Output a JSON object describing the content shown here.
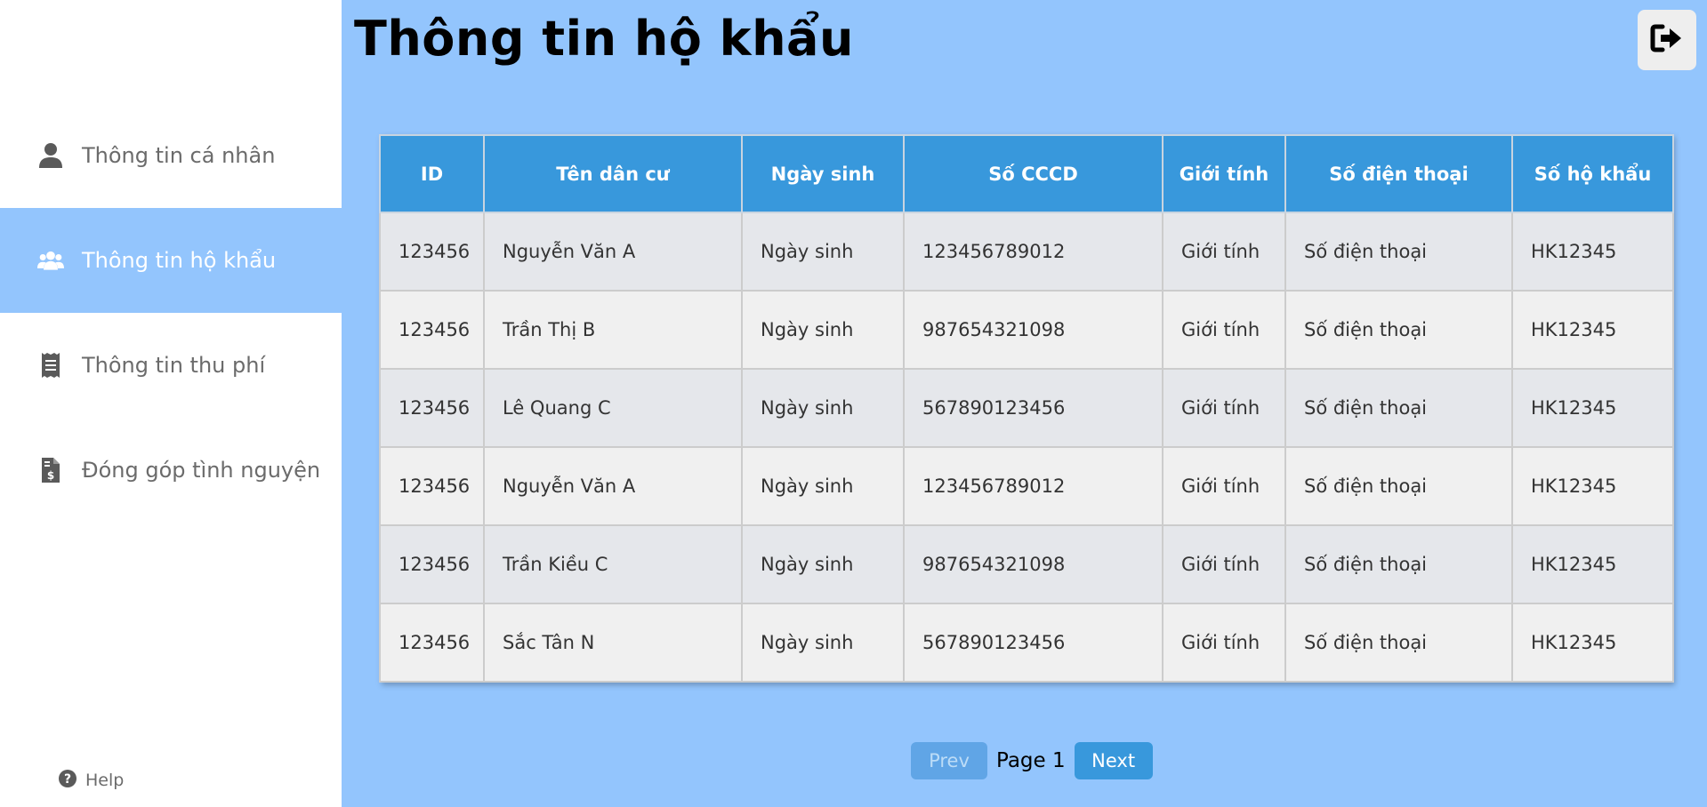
{
  "sidebar": {
    "items": [
      {
        "label": "Thông tin cá nhân",
        "icon": "user-icon"
      },
      {
        "label": "Thông tin hộ khẩu",
        "icon": "users-icon",
        "active": true
      },
      {
        "label": "Thông tin thu phí",
        "icon": "receipt-icon"
      },
      {
        "label": "Đóng góp tình nguyện",
        "icon": "file-invoice-dollar-icon"
      }
    ],
    "help_label": "Help"
  },
  "header": {
    "title": "Thông tin hộ khẩu",
    "logout_icon": "sign-out-icon"
  },
  "table": {
    "columns": [
      "ID",
      "Tên dân cư",
      "Ngày sinh",
      "Số CCCD",
      "Giới tính",
      "Số điện thoại",
      "Số hộ khẩu"
    ],
    "rows": [
      [
        "123456",
        "Nguyễn Văn A",
        "Ngày sinh",
        "123456789012",
        "Giới tính",
        "Số điện thoại",
        "HK12345"
      ],
      [
        "123456",
        "Trần Thị B",
        "Ngày sinh",
        "987654321098",
        "Giới tính",
        "Số điện thoại",
        "HK12345"
      ],
      [
        "123456",
        "Lê Quang C",
        "Ngày sinh",
        "567890123456",
        "Giới tính",
        "Số điện thoại",
        "HK12345"
      ],
      [
        "123456",
        "Nguyễn Văn A",
        "Ngày sinh",
        "123456789012",
        "Giới tính",
        "Số điện thoại",
        "HK12345"
      ],
      [
        "123456",
        "Trần Kiều C",
        "Ngày sinh",
        "987654321098",
        "Giới tính",
        "Số điện thoại",
        "HK12345"
      ],
      [
        "123456",
        "Sắc Tân N",
        "Ngày sinh",
        "567890123456",
        "Giới tính",
        "Số điện thoại",
        "HK12345"
      ]
    ]
  },
  "pagination": {
    "prev_label": "Prev",
    "page_label": "Page 1",
    "next_label": "Next"
  },
  "colors": {
    "background": "#93c5fd",
    "header": "#3898dc",
    "sidebar": "#ffffff"
  }
}
